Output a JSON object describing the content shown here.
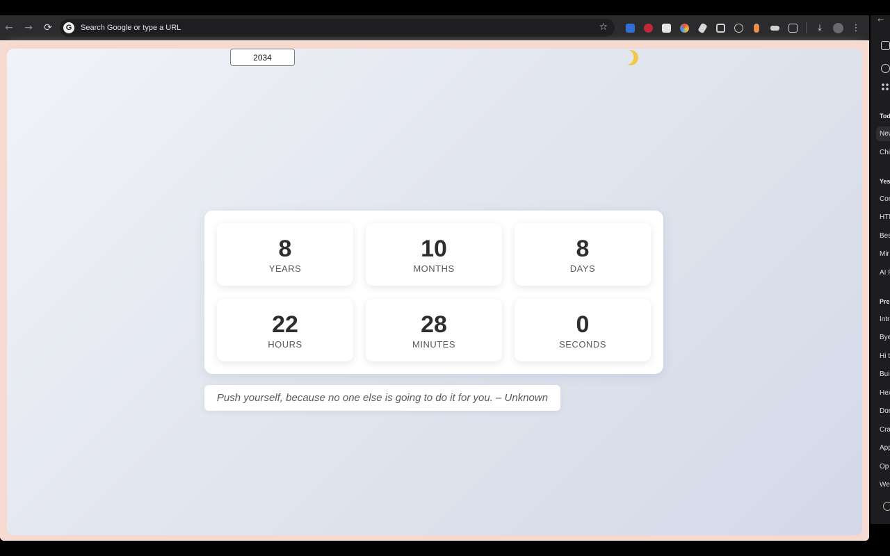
{
  "browser": {
    "omnibox_placeholder": "Search Google or type a URL",
    "google_letter": "G",
    "nav": {
      "back": "←",
      "forward": "→",
      "reload": "⟳"
    },
    "star": "☆",
    "extensions": [
      {
        "name": "bitwarden-icon",
        "color": "#2f6fd6"
      },
      {
        "name": "red-circle-extension-icon",
        "color": "#c2283a"
      },
      {
        "name": "notion-icon",
        "color": "#e5e5e5"
      },
      {
        "name": "colorful-circle-extension-icon",
        "color": "#e8553b"
      },
      {
        "name": "pen-extension-icon",
        "color": "#d8d8d8"
      },
      {
        "name": "window-extension-icon",
        "color": "#cfcfcf"
      },
      {
        "name": "circle-extension-icon",
        "color": "#cfcfcf"
      },
      {
        "name": "pill-extension-icon",
        "color": "#e88d4a"
      },
      {
        "name": "incognito-extension-icon",
        "color": "#d0d0d0"
      },
      {
        "name": "puzzle-extensions-icon",
        "color": "#d0d0d0"
      }
    ],
    "download_glyph": "⤓",
    "menu_glyph": "⋮"
  },
  "page": {
    "year_value": "2034",
    "countdown": [
      {
        "value": "8",
        "label": "YEARS"
      },
      {
        "value": "10",
        "label": "MONTHS"
      },
      {
        "value": "8",
        "label": "DAYS"
      },
      {
        "value": "22",
        "label": "HOURS"
      },
      {
        "value": "28",
        "label": "MINUTES"
      },
      {
        "value": "0",
        "label": "SECONDS"
      }
    ],
    "quote": "Push yourself, because no one else is going to do it for you. – Unknown"
  },
  "sidepanel": {
    "back_glyph": "←",
    "groups": [
      {
        "heading": "Tod",
        "items": [
          "New",
          "Chi"
        ]
      },
      {
        "heading": "Yes",
        "items": [
          "Cor",
          "HTI",
          "Bes",
          "Mir",
          "AI F"
        ]
      },
      {
        "heading": "Pre",
        "items": [
          "Intr",
          "Bye",
          "Hi t",
          "Buil",
          "Hex",
          "Dor",
          "Cra",
          "App",
          "Op",
          "We"
        ]
      }
    ]
  },
  "colors": {
    "moon": "#f2c84b",
    "page_border": "#f7dcd4"
  }
}
